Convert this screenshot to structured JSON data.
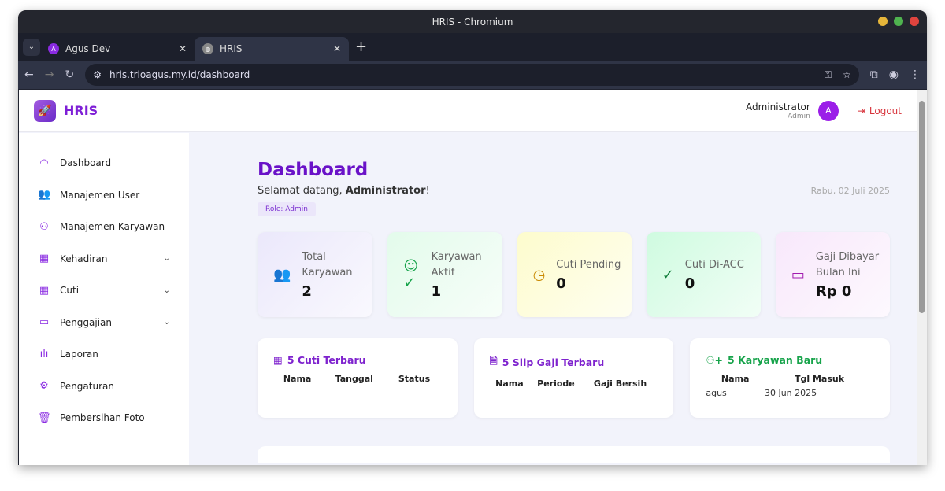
{
  "window": {
    "title": "HRIS - Chromium"
  },
  "tabs": [
    {
      "label": "Agus Dev",
      "favicon": "A"
    },
    {
      "label": "HRIS"
    }
  ],
  "toolbar": {
    "url": "hris.trioagus.my.id/dashboard"
  },
  "header": {
    "brand": "HRIS",
    "user_name": "Administrator",
    "user_role": "Admin",
    "avatar": "A",
    "logout": "Logout"
  },
  "sidebar": {
    "items": [
      {
        "label": "Dashboard",
        "icon": "gauge-icon"
      },
      {
        "label": "Manajemen User",
        "icon": "users-icon"
      },
      {
        "label": "Manajemen Karyawan",
        "icon": "user-icon"
      },
      {
        "label": "Kehadiran",
        "icon": "calendar-check-icon",
        "expandable": true
      },
      {
        "label": "Cuti",
        "icon": "calendar-x-icon",
        "expandable": true
      },
      {
        "label": "Penggajian",
        "icon": "wallet-icon",
        "expandable": true
      },
      {
        "label": "Laporan",
        "icon": "bar-chart-icon"
      },
      {
        "label": "Pengaturan",
        "icon": "gear-icon"
      },
      {
        "label": "Pembersihan Foto",
        "icon": "trash-icon"
      }
    ]
  },
  "main": {
    "title": "Dashboard",
    "welcome_prefix": "Selamat datang, ",
    "welcome_name": "Administrator",
    "welcome_suffix": "!",
    "date": "Rabu, 02 Juli 2025",
    "role": "Role: Admin",
    "stats": [
      {
        "label": "Total Karyawan",
        "value": "2",
        "color": "#7e22ce",
        "bg": "#ebe8fb"
      },
      {
        "label": "Karyawan Aktif",
        "value": "1",
        "color": "#16a34a",
        "bg": "#e3fbeb"
      },
      {
        "label": "Cuti Pending",
        "value": "0",
        "color": "#ca8a04",
        "bg": "#fdfccd"
      },
      {
        "label": "Cuti Di-ACC",
        "value": "0",
        "color": "#15803d",
        "bg": "#cffbe0"
      },
      {
        "label": "Gaji Dibayar Bulan Ini",
        "value": "Rp 0",
        "color": "#a21caf",
        "bg": "#f8e8fb"
      }
    ],
    "cards": [
      {
        "title": "5 Cuti Terbaru",
        "color": "#7e22ce",
        "columns": [
          "Nama",
          "Tanggal",
          "Status"
        ],
        "rows": []
      },
      {
        "title": "5 Slip Gaji Terbaru",
        "color": "#7e22ce",
        "columns": [
          "Nama",
          "Periode",
          "Gaji Bersih"
        ],
        "rows": []
      },
      {
        "title": "5 Karyawan Baru",
        "color": "#16a34a",
        "columns": [
          "Nama",
          "Tgl Masuk"
        ],
        "rows": [
          [
            "agus",
            "30 Jun 2025"
          ]
        ]
      }
    ]
  }
}
